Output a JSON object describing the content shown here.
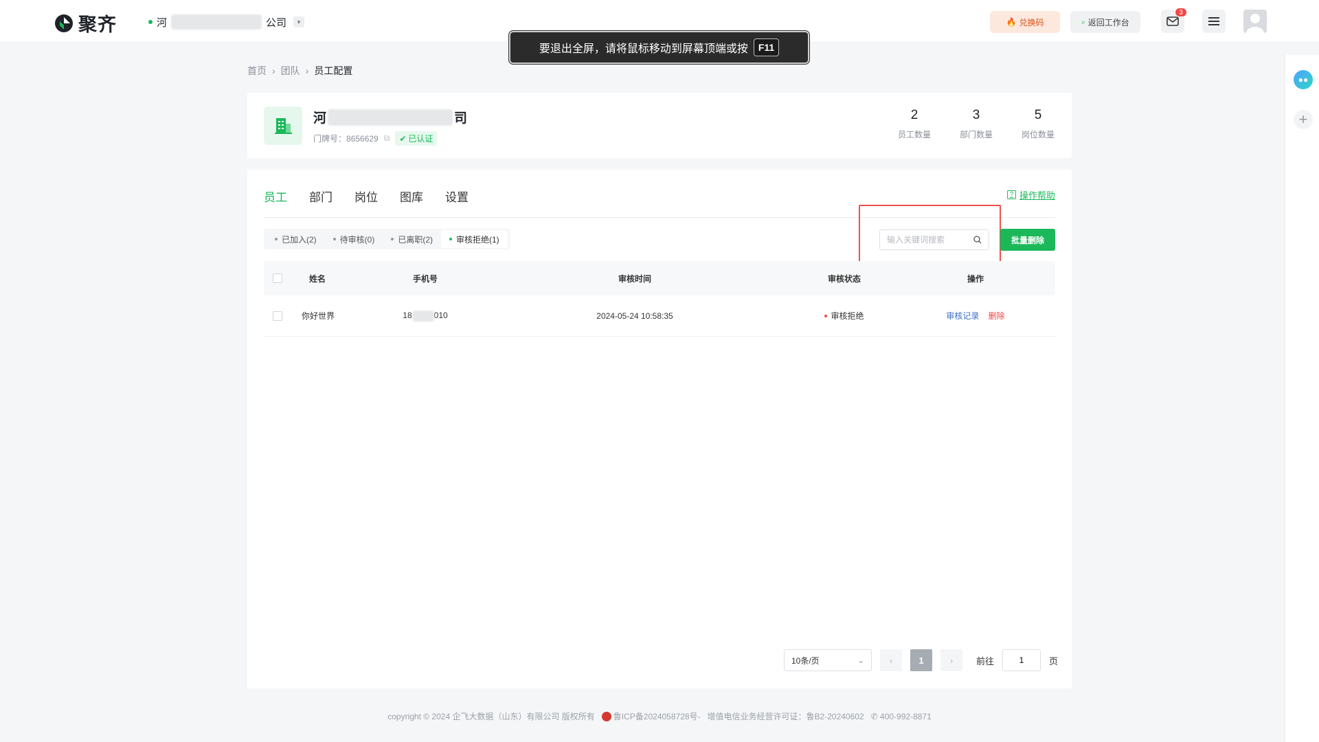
{
  "header": {
    "logo_text": "聚齐",
    "org_prefix": "河",
    "org_suffix": "公司",
    "redeem_label": "兑换码",
    "back_label": "返回工作台",
    "mail_badge": "3"
  },
  "toast": {
    "message": "要退出全屏，请将鼠标移动到屏幕顶端或按",
    "key": "F11"
  },
  "breadcrumb": {
    "home": "首页",
    "team": "团队",
    "current": "员工配置"
  },
  "company": {
    "name_prefix": "河",
    "name_suffix": "司",
    "plate_label": "门牌号：",
    "plate_number": "8656629",
    "verified_label": "已认证",
    "stats": [
      {
        "value": "2",
        "label": "员工数量"
      },
      {
        "value": "3",
        "label": "部门数量"
      },
      {
        "value": "5",
        "label": "岗位数量"
      }
    ]
  },
  "tabs": [
    "员工",
    "部门",
    "岗位",
    "图库",
    "设置"
  ],
  "active_tab": 0,
  "help_label": "操作帮助",
  "subtabs": [
    "已加入(2)",
    "待审核(0)",
    "已离职(2)",
    "审核拒绝(1)"
  ],
  "search": {
    "placeholder": "输入关键词搜索"
  },
  "batch_delete_label": "批量删除",
  "table": {
    "headers": {
      "name": "姓名",
      "phone": "手机号",
      "time": "审核时间",
      "status": "审核状态",
      "op": "操作"
    },
    "rows": [
      {
        "name": "你好世界",
        "phone_prefix": "18",
        "phone_suffix": "010",
        "time": "2024-05-24 10:58:35",
        "status": "审核拒绝",
        "op_record": "审核记录",
        "op_delete": "删除"
      }
    ]
  },
  "pagination": {
    "page_size": "10条/页",
    "current_page": "1",
    "goto_label": "前往",
    "goto_value": "1",
    "page_unit": "页"
  },
  "footer": {
    "copyright": "copyright © 2024 企飞大数据（山东）有限公司 版权所有",
    "icp": "鲁ICP备2024058728号-",
    "license": "增值电信业务经营许可证：鲁B2-20240602",
    "phone": "400-992-8871"
  },
  "colors": {
    "brand": "#1bb85a",
    "danger": "#f04646",
    "link": "#3b6ec7"
  }
}
